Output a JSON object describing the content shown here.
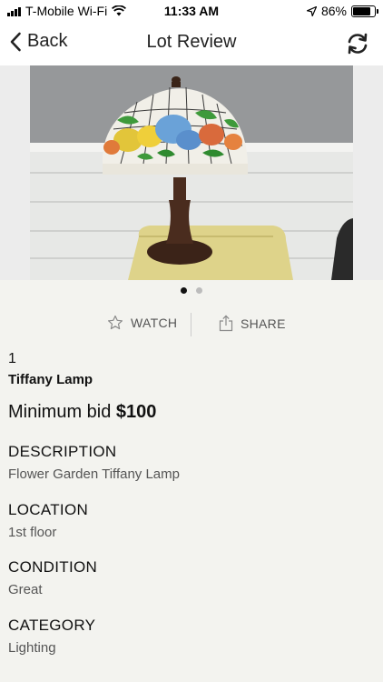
{
  "status": {
    "carrier": "T-Mobile Wi-Fi",
    "time": "11:33 AM",
    "battery": "86%",
    "battery_level": 0.86
  },
  "nav": {
    "back_label": "Back",
    "title": "Lot Review"
  },
  "carousel": {
    "image_count": 2,
    "active_index": 0
  },
  "actions": {
    "watch_label": "WATCH",
    "share_label": "SHARE"
  },
  "lot": {
    "number": "1",
    "name": "Tiffany Lamp",
    "min_bid_label": "Minimum bid",
    "min_bid_value": "$100"
  },
  "fields": [
    {
      "label": "DESCRIPTION",
      "value": "Flower Garden Tiffany Lamp"
    },
    {
      "label": "LOCATION",
      "value": "1st floor"
    },
    {
      "label": "CONDITION",
      "value": "Great"
    },
    {
      "label": "CATEGORY",
      "value": "Lighting"
    }
  ],
  "colors": {
    "background": "#f3f3ef",
    "label": "#111111",
    "secondary": "#555555"
  }
}
